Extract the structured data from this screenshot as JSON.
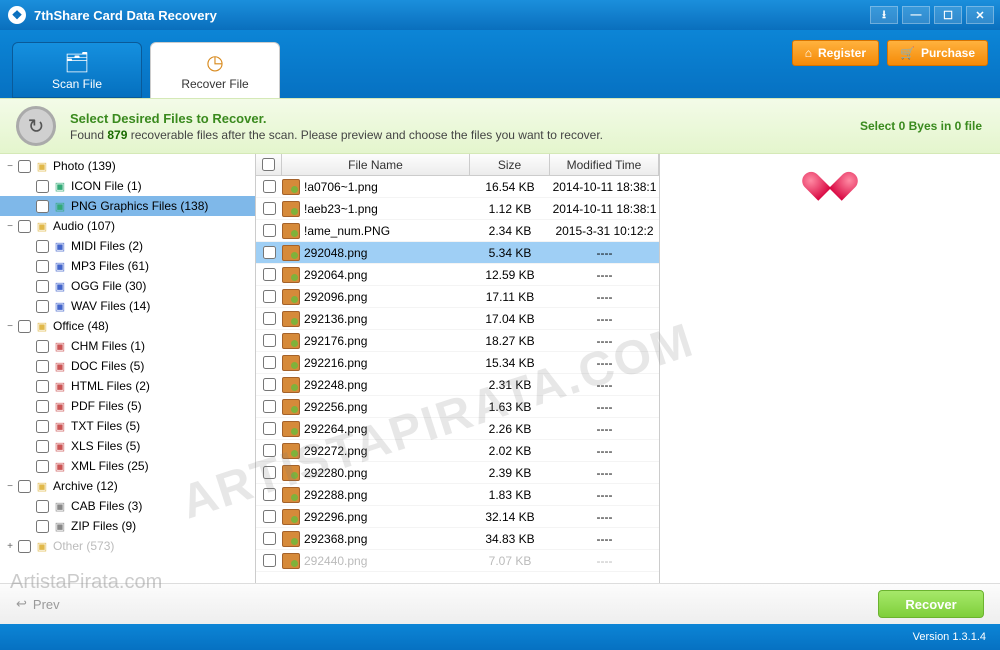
{
  "title": "7thShare Card Data Recovery",
  "toolbar": {
    "scan_tab": "Scan File",
    "recover_tab": "Recover File",
    "register_label": "Register",
    "purchase_label": "Purchase"
  },
  "info": {
    "heading": "Select Desired Files to Recover.",
    "before_count": "Found ",
    "count": "879",
    "after_count": " recoverable files after the scan. Please preview and choose the files you want to recover.",
    "selection_summary": "Select 0 Byes in 0 file"
  },
  "tree": [
    {
      "toggle": "−",
      "depth": 0,
      "label": "Photo (139)",
      "cls": "ti-folder"
    },
    {
      "toggle": "",
      "depth": 1,
      "label": "ICON File (1)",
      "cls": "ti-img"
    },
    {
      "toggle": "",
      "depth": 1,
      "label": "PNG Graphics Files (138)",
      "cls": "ti-img",
      "selected": true
    },
    {
      "toggle": "−",
      "depth": 0,
      "label": "Audio (107)",
      "cls": "ti-folder"
    },
    {
      "toggle": "",
      "depth": 1,
      "label": "MIDI Files (2)",
      "cls": "ti-audio"
    },
    {
      "toggle": "",
      "depth": 1,
      "label": "MP3 Files (61)",
      "cls": "ti-audio"
    },
    {
      "toggle": "",
      "depth": 1,
      "label": "OGG File (30)",
      "cls": "ti-audio"
    },
    {
      "toggle": "",
      "depth": 1,
      "label": "WAV Files (14)",
      "cls": "ti-audio"
    },
    {
      "toggle": "−",
      "depth": 0,
      "label": "Office (48)",
      "cls": "ti-folder"
    },
    {
      "toggle": "",
      "depth": 1,
      "label": "CHM Files (1)",
      "cls": "ti-doc"
    },
    {
      "toggle": "",
      "depth": 1,
      "label": "DOC Files (5)",
      "cls": "ti-doc"
    },
    {
      "toggle": "",
      "depth": 1,
      "label": "HTML Files (2)",
      "cls": "ti-doc"
    },
    {
      "toggle": "",
      "depth": 1,
      "label": "PDF Files (5)",
      "cls": "ti-doc"
    },
    {
      "toggle": "",
      "depth": 1,
      "label": "TXT Files (5)",
      "cls": "ti-doc"
    },
    {
      "toggle": "",
      "depth": 1,
      "label": "XLS Files (5)",
      "cls": "ti-doc"
    },
    {
      "toggle": "",
      "depth": 1,
      "label": "XML Files (25)",
      "cls": "ti-doc"
    },
    {
      "toggle": "−",
      "depth": 0,
      "label": "Archive (12)",
      "cls": "ti-folder"
    },
    {
      "toggle": "",
      "depth": 1,
      "label": "CAB Files (3)",
      "cls": "ti-arc"
    },
    {
      "toggle": "",
      "depth": 1,
      "label": "ZIP Files (9)",
      "cls": "ti-arc"
    },
    {
      "toggle": "+",
      "depth": 0,
      "label": "Other (573)",
      "cls": "ti-folder",
      "dim": true
    }
  ],
  "file_header": {
    "name": "File Name",
    "size": "Size",
    "time": "Modified Time"
  },
  "files": [
    {
      "name": "!a0706~1.png",
      "size": "16.54 KB",
      "time": "2014-10-11 18:38:1"
    },
    {
      "name": "!aeb23~1.png",
      "size": "1.12 KB",
      "time": "2014-10-11 18:38:1"
    },
    {
      "name": "!ame_num.PNG",
      "size": "2.34 KB",
      "time": "2015-3-31 10:12:2"
    },
    {
      "name": "292048.png",
      "size": "5.34 KB",
      "time": "----",
      "selected": true
    },
    {
      "name": "292064.png",
      "size": "12.59 KB",
      "time": "----"
    },
    {
      "name": "292096.png",
      "size": "17.11 KB",
      "time": "----"
    },
    {
      "name": "292136.png",
      "size": "17.04 KB",
      "time": "----"
    },
    {
      "name": "292176.png",
      "size": "18.27 KB",
      "time": "----"
    },
    {
      "name": "292216.png",
      "size": "15.34 KB",
      "time": "----"
    },
    {
      "name": "292248.png",
      "size": "2.31 KB",
      "time": "----"
    },
    {
      "name": "292256.png",
      "size": "1.63 KB",
      "time": "----"
    },
    {
      "name": "292264.png",
      "size": "2.26 KB",
      "time": "----"
    },
    {
      "name": "292272.png",
      "size": "2.02 KB",
      "time": "----"
    },
    {
      "name": "292280.png",
      "size": "2.39 KB",
      "time": "----"
    },
    {
      "name": "292288.png",
      "size": "1.83 KB",
      "time": "----"
    },
    {
      "name": "292296.png",
      "size": "32.14 KB",
      "time": "----"
    },
    {
      "name": "292368.png",
      "size": "34.83 KB",
      "time": "----"
    },
    {
      "name": "292440.png",
      "size": "7.07 KB",
      "time": "----",
      "dim": true
    }
  ],
  "footer": {
    "prev": "Prev",
    "recover": "Recover"
  },
  "status": {
    "version": "Version 1.3.1.4"
  },
  "watermark": "ARTISTAPIRATA.COM",
  "watermark2": "ArtistaPirata.com"
}
